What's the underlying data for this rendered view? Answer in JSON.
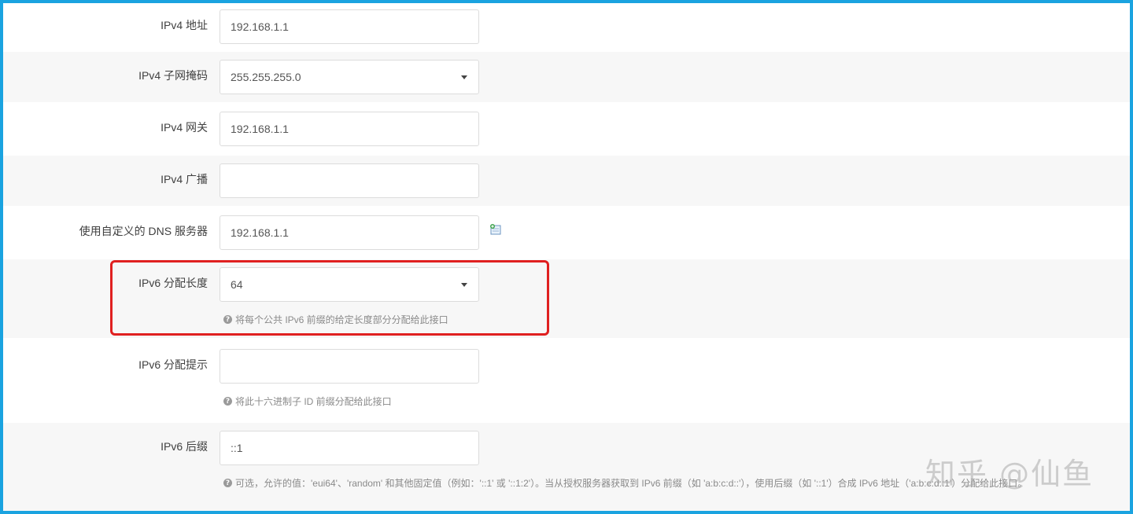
{
  "fields": {
    "ipv4_address": {
      "label": "IPv4 地址",
      "value": "192.168.1.1"
    },
    "ipv4_netmask": {
      "label": "IPv4 子网掩码",
      "value": "255.255.255.0"
    },
    "ipv4_gateway": {
      "label": "IPv4 网关",
      "value": "192.168.1.1"
    },
    "ipv4_broadcast": {
      "label": "IPv4 广播",
      "value": ""
    },
    "custom_dns": {
      "label": "使用自定义的 DNS 服务器",
      "value": "192.168.1.1"
    },
    "ipv6_assign_length": {
      "label": "IPv6 分配长度",
      "value": "64",
      "help": "将每个公共 IPv6 前缀的给定长度部分分配给此接口"
    },
    "ipv6_assign_hint": {
      "label": "IPv6 分配提示",
      "value": "",
      "help": "将此十六进制子 ID 前缀分配给此接口"
    },
    "ipv6_suffix": {
      "label": "IPv6 后缀",
      "value": "::1",
      "help": "可选，允许的值：'eui64'、'random' 和其他固定值（例如：'::1' 或 '::1:2'）。当从授权服务器获取到 IPv6 前缀（如 'a:b:c:d::'），使用后缀（如 '::1'）合成 IPv6 地址（'a:b:c:d::1'）分配给此接口。"
    }
  },
  "icons": {
    "help": "question-circle-icon",
    "add": "add-entry-icon",
    "select": "chevron-down-icon"
  },
  "watermark": "知乎 @仙鱼",
  "colors": {
    "frame": "#1aa3e0",
    "highlight": "#e02020",
    "alt_row": "#f7f7f7"
  }
}
